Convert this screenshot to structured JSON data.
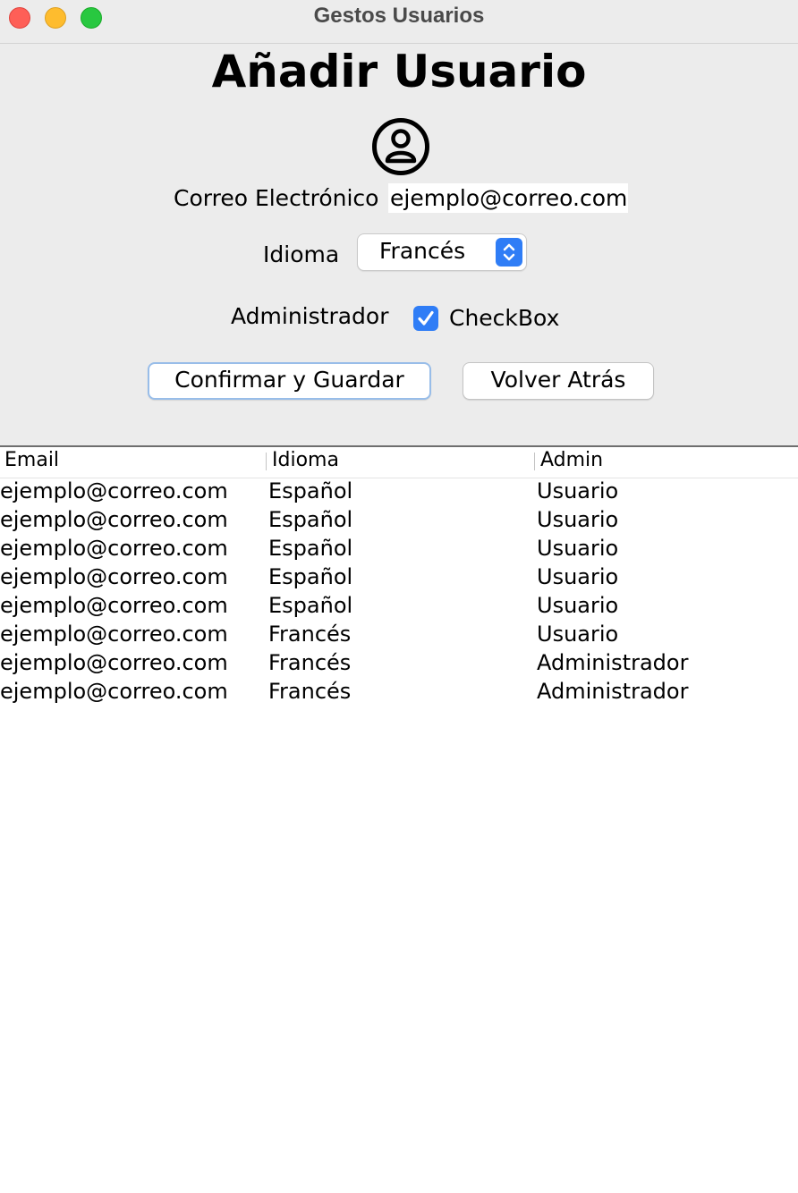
{
  "window": {
    "title": "Gestos Usuarios"
  },
  "form": {
    "heading": "Añadir Usuario",
    "email_label": "Correo Electrónico",
    "email_value": "ejemplo@correo.com",
    "language_label": "Idioma",
    "language_selected": "Francés",
    "admin_label": "Administrador",
    "checkbox_label": "CheckBox",
    "checkbox_checked": true,
    "confirm_button": "Confirmar y Guardar",
    "back_button": "Volver Atrás"
  },
  "table": {
    "columns": [
      "Email",
      "Idioma",
      "Admin"
    ],
    "rows": [
      [
        "ejemplo@correo.com",
        "Español",
        "Usuario"
      ],
      [
        "ejemplo@correo.com",
        "Español",
        "Usuario"
      ],
      [
        "ejemplo@correo.com",
        "Español",
        "Usuario"
      ],
      [
        "ejemplo@correo.com",
        "Español",
        "Usuario"
      ],
      [
        "ejemplo@correo.com",
        "Español",
        "Usuario"
      ],
      [
        "ejemplo@correo.com",
        "Francés",
        "Usuario"
      ],
      [
        "ejemplo@correo.com",
        "Francés",
        "Administrador"
      ],
      [
        "ejemplo@correo.com",
        "Francés",
        "Administrador"
      ]
    ]
  },
  "colors": {
    "accent": "#2f7df6",
    "close": "#fe5f57",
    "minimize": "#febc2e",
    "zoom": "#28c840"
  },
  "icons": [
    "close-button",
    "minimize-button",
    "zoom-button",
    "user-icon",
    "chevron-up-down-icon",
    "checkmark-icon"
  ]
}
